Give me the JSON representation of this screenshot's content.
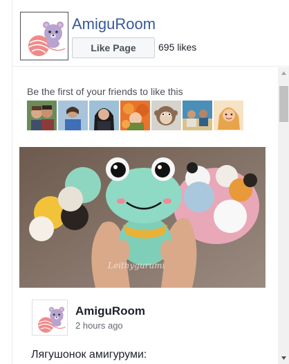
{
  "header": {
    "page_name": "AmiguRoom",
    "like_button_label": "Like Page",
    "likes_count": "695 likes"
  },
  "social": {
    "friends_prompt": "Be the first of your friends to like this",
    "friend_avatars": [
      "friend-avatar",
      "friend-avatar",
      "friend-avatar",
      "friend-avatar",
      "friend-avatar",
      "friend-avatar",
      "friend-avatar"
    ]
  },
  "post": {
    "author": "AmiguRoom",
    "time": "2 hours ago",
    "photo_watermark": "Leithygurumi",
    "text": "Лягушонок амигуруми:"
  },
  "colors": {
    "link_blue": "#365899",
    "border": "#e9ebee",
    "scrollbar_track": "#f1f1f1",
    "scrollbar_thumb": "#c1c1c1"
  }
}
